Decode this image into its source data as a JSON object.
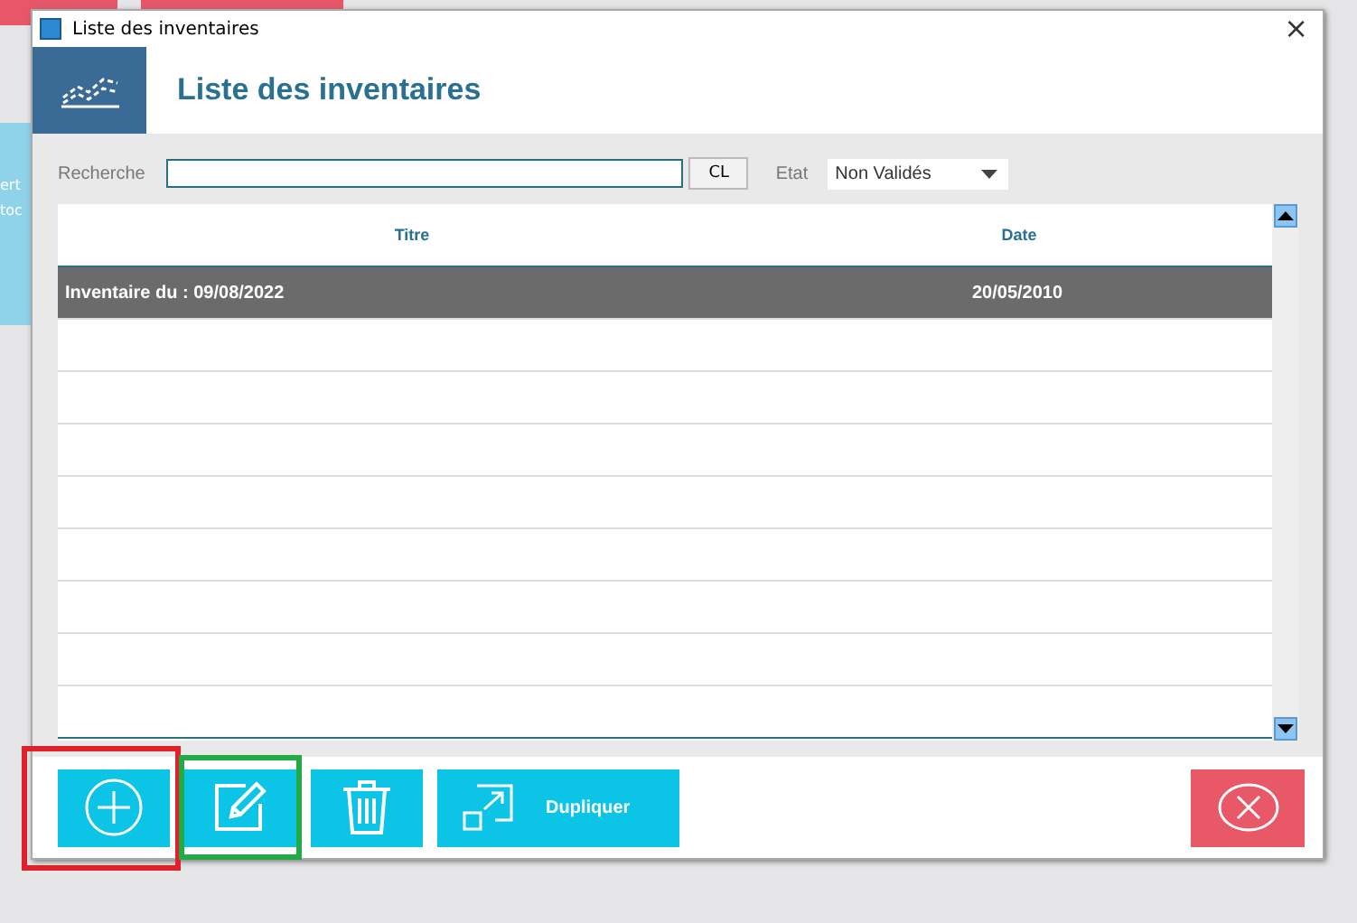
{
  "background_tiles": [
    {
      "color": "#e8566a"
    },
    {
      "color": "#e8566a"
    },
    {
      "color": "#8fd3ea",
      "lines": [
        "ert",
        "toc"
      ]
    }
  ],
  "window": {
    "title": "Liste des inventaires",
    "close": "×"
  },
  "header": {
    "title": "Liste des inventaires"
  },
  "search": {
    "label": "Recherche",
    "clear_button": "CL"
  },
  "state_filter": {
    "label": "Etat",
    "value": "Non Validés"
  },
  "table": {
    "columns": [
      "Titre",
      "Date"
    ],
    "rows": [
      {
        "cells": [
          "Inventaire du : 09/08/2022",
          "20/05/2010"
        ],
        "selected": true
      }
    ]
  },
  "toolbar": [
    {
      "kind": "add"
    },
    {
      "kind": "edit"
    },
    {
      "kind": "delete"
    },
    {
      "kind": "duplicate",
      "label": "Dupliquer"
    }
  ],
  "close_button": {
    "kind": "close"
  },
  "highlights": [
    {
      "color": "#e0202a"
    },
    {
      "color": "#22aa44"
    }
  ]
}
